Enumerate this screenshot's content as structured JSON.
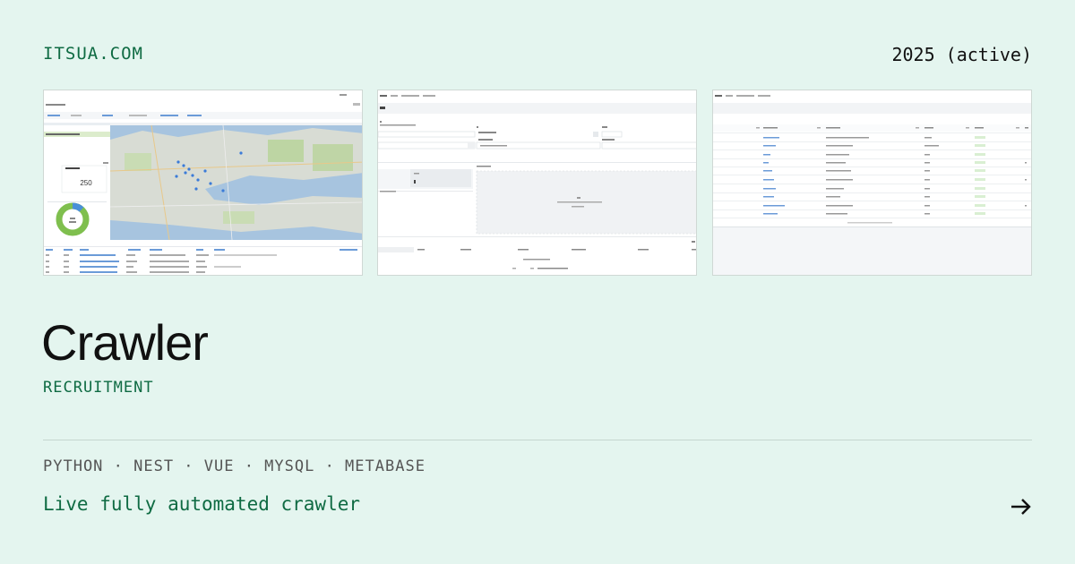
{
  "header": {
    "site": "ITSUA.COM",
    "year": "2025 (active)"
  },
  "project": {
    "title": "Crawler",
    "category": "RECRUITMENT",
    "stack": "PYTHON · NEST · VUE · MYSQL · METABASE",
    "tagline": "Live fully automated crawler"
  },
  "screenshots": {
    "dashboard": {
      "metric_value": "250"
    }
  },
  "icons": {
    "next": "arrow-right-icon"
  },
  "colors": {
    "background": "#e4f5ef",
    "accent": "#0f6b43",
    "text": "#111111",
    "muted": "#555555"
  }
}
